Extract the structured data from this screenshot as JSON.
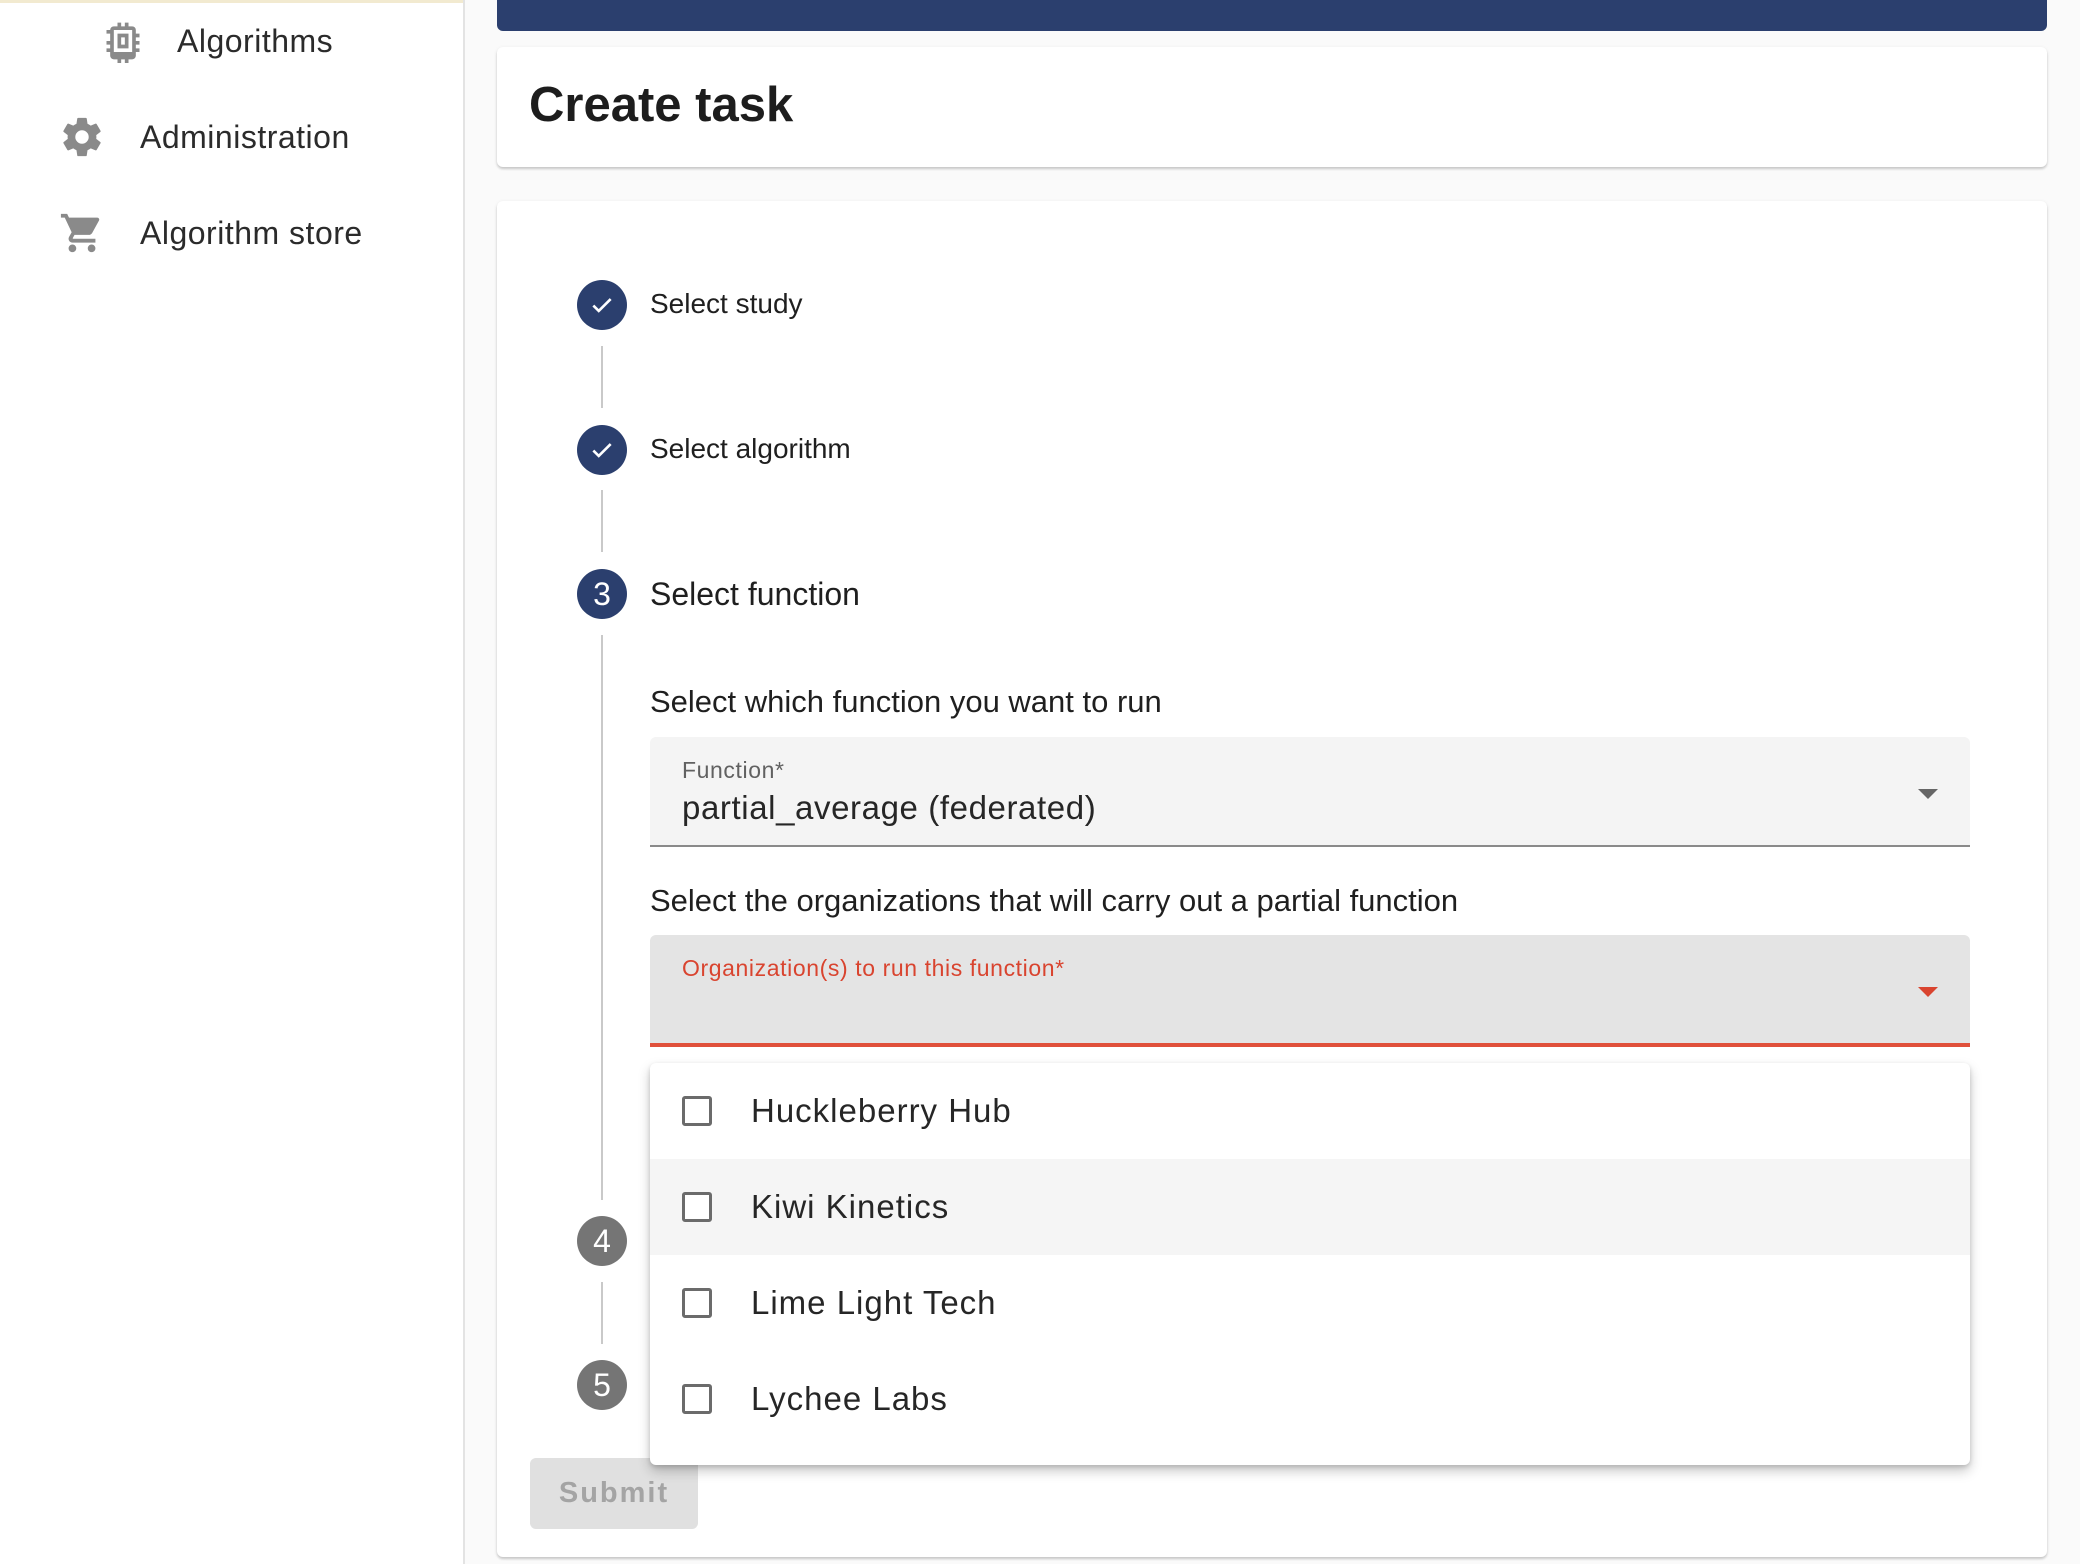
{
  "sidebar": {
    "items": [
      {
        "label": "Algorithms",
        "icon": "chip-icon"
      },
      {
        "label": "Administration",
        "icon": "gear-icon"
      },
      {
        "label": "Algorithm store",
        "icon": "cart-icon"
      }
    ]
  },
  "page": {
    "title": "Create task"
  },
  "stepper": {
    "steps": [
      {
        "number": "1",
        "label": "Select study",
        "state": "completed"
      },
      {
        "number": "2",
        "label": "Select algorithm",
        "state": "completed"
      },
      {
        "number": "3",
        "label": "Select function",
        "state": "active"
      },
      {
        "number": "4",
        "label": "",
        "state": "pending"
      },
      {
        "number": "5",
        "label": "",
        "state": "pending"
      }
    ]
  },
  "function_step": {
    "function_prompt": "Select which function you want to run",
    "function_select": {
      "label": "Function*",
      "value": "partial_average (federated)"
    },
    "org_prompt": "Select the organizations that will carry out a partial function",
    "org_select": {
      "label": "Organization(s) to run this function*",
      "value": ""
    }
  },
  "org_options": [
    {
      "label": "Huckleberry Hub",
      "checked": false
    },
    {
      "label": "Kiwi Kinetics",
      "checked": false
    },
    {
      "label": "Lime Light Tech",
      "checked": false
    },
    {
      "label": "Lychee Labs",
      "checked": false
    }
  ],
  "submit": {
    "label": "Submit",
    "disabled": true
  },
  "colors": {
    "primary": "#2b3f6e",
    "error": "#d9442f",
    "pending": "#757575"
  }
}
